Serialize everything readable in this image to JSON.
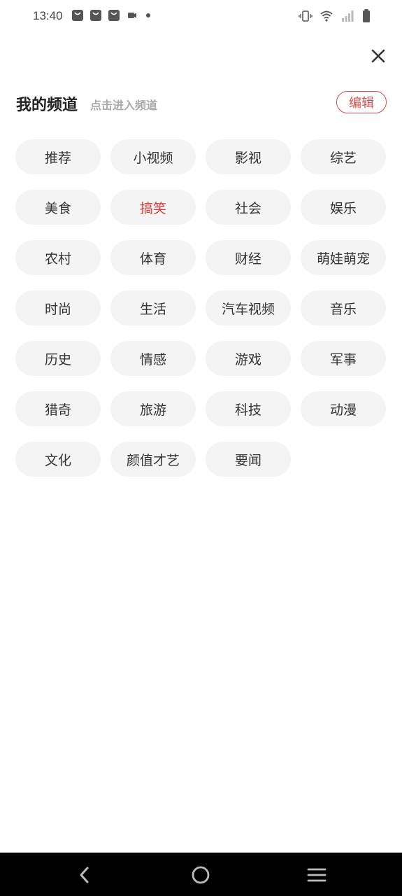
{
  "status_bar": {
    "time": "13:40"
  },
  "header": {
    "title": "我的频道",
    "subtitle": "点击进入频道",
    "edit_label": "编辑"
  },
  "colors": {
    "accent": "#e03b3b",
    "chip_bg": "#f4f4f4"
  },
  "channels": [
    {
      "label": "推荐"
    },
    {
      "label": "小视频"
    },
    {
      "label": "影视"
    },
    {
      "label": "综艺"
    },
    {
      "label": "美食"
    },
    {
      "label": "搞笑",
      "active": true
    },
    {
      "label": "社会"
    },
    {
      "label": "娱乐"
    },
    {
      "label": "农村"
    },
    {
      "label": "体育"
    },
    {
      "label": "财经"
    },
    {
      "label": "萌娃萌宠"
    },
    {
      "label": "时尚"
    },
    {
      "label": "生活"
    },
    {
      "label": "汽车视频"
    },
    {
      "label": "音乐"
    },
    {
      "label": "历史"
    },
    {
      "label": "情感"
    },
    {
      "label": "游戏"
    },
    {
      "label": "军事"
    },
    {
      "label": "猎奇"
    },
    {
      "label": "旅游"
    },
    {
      "label": "科技"
    },
    {
      "label": "动漫"
    },
    {
      "label": "文化"
    },
    {
      "label": "颜值才艺"
    },
    {
      "label": "要闻"
    }
  ]
}
